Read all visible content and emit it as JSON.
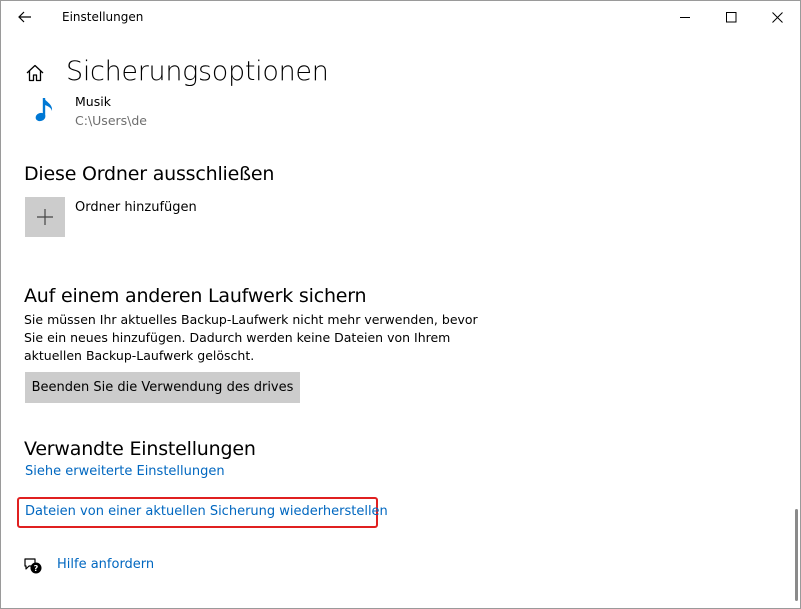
{
  "window": {
    "title": "Einstellungen"
  },
  "header": {
    "title": "Sicherungsoptionen"
  },
  "folder_item": {
    "name": "Musik",
    "path": "C:\\Users\\de"
  },
  "exclude_section": {
    "title": "Diese Ordner ausschließen",
    "add_label": "Ordner hinzufügen"
  },
  "other_drive_section": {
    "title": "Auf einem anderen Laufwerk sichern",
    "description": "Sie müssen Ihr aktuelles Backup-Laufwerk nicht mehr verwenden, bevor Sie ein neues hinzufügen. Dadurch werden keine Dateien von Ihrem aktuellen Backup-Laufwerk gelöscht.",
    "stop_button_label": "Beenden Sie die Verwendung des drives"
  },
  "related_section": {
    "title": "Verwandte Einstellungen",
    "advanced_link": "Siehe erweiterte Einstellungen",
    "restore_link": "Dateien von einer aktuellen Sicherung wiederherstellen"
  },
  "help": {
    "label": "Hilfe anfordern"
  },
  "icons": {
    "back": "back-arrow-icon",
    "home": "home-icon",
    "music": "music-note-icon",
    "add": "plus-icon",
    "help": "help-chat-icon"
  },
  "colors": {
    "link": "#0067c0",
    "music_icon": "#0078d4",
    "highlight": "#e02020",
    "tile": "#cccccc"
  }
}
